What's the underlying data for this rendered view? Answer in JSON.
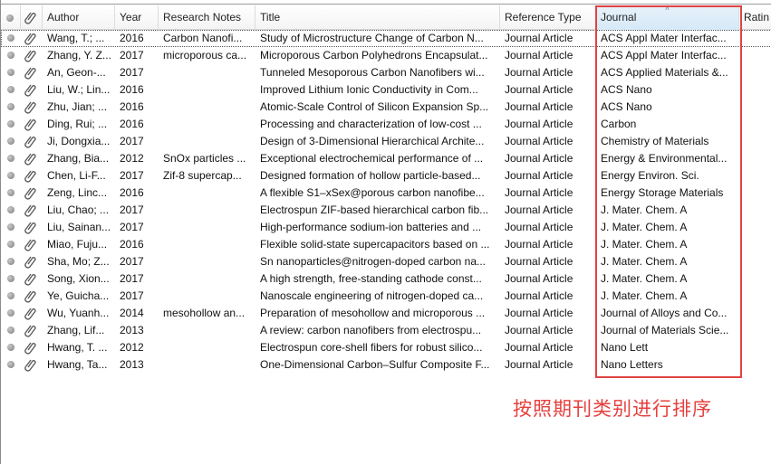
{
  "columns": {
    "author": "Author",
    "year": "Year",
    "notes": "Research Notes",
    "title": "Title",
    "reftype": "Reference Type",
    "journal": "Journal",
    "rating": "Ratin"
  },
  "sort_indicator": "^",
  "rows": [
    {
      "author": "Wang, T.; ...",
      "year": "2016",
      "notes": "Carbon Nanofi...",
      "title": "Study of Microstructure Change of Carbon N...",
      "reftype": "Journal Article",
      "journal": "ACS Appl Mater Interfac..."
    },
    {
      "author": "Zhang, Y. Z...",
      "year": "2017",
      "notes": "microporous ca...",
      "title": "Microporous Carbon Polyhedrons Encapsulat...",
      "reftype": "Journal Article",
      "journal": "ACS Appl Mater Interfac..."
    },
    {
      "author": "An, Geon-...",
      "year": "2017",
      "notes": "",
      "title": "Tunneled Mesoporous Carbon Nanofibers wi...",
      "reftype": "Journal Article",
      "journal": "ACS Applied Materials &..."
    },
    {
      "author": "Liu, W.; Lin...",
      "year": "2016",
      "notes": "",
      "title": "Improved Lithium Ionic Conductivity in Com...",
      "reftype": "Journal Article",
      "journal": "ACS Nano"
    },
    {
      "author": "Zhu, Jian; ...",
      "year": "2016",
      "notes": "",
      "title": "Atomic-Scale Control of Silicon Expansion Sp...",
      "reftype": "Journal Article",
      "journal": "ACS Nano"
    },
    {
      "author": "Ding, Rui; ...",
      "year": "2016",
      "notes": "",
      "title": "Processing and characterization of low-cost ...",
      "reftype": "Journal Article",
      "journal": "Carbon"
    },
    {
      "author": "Ji, Dongxia...",
      "year": "2017",
      "notes": "",
      "title": "Design of 3-Dimensional Hierarchical Archite...",
      "reftype": "Journal Article",
      "journal": "Chemistry of Materials"
    },
    {
      "author": "Zhang, Bia...",
      "year": "2012",
      "notes": "SnOx particles ...",
      "title": "Exceptional electrochemical performance of ...",
      "reftype": "Journal Article",
      "journal": "Energy & Environmental..."
    },
    {
      "author": "Chen, Li-F...",
      "year": "2017",
      "notes": "Zif-8 supercap...",
      "title": "Designed formation of hollow particle-based...",
      "reftype": "Journal Article",
      "journal": "Energy Environ. Sci."
    },
    {
      "author": "Zeng, Linc...",
      "year": "2016",
      "notes": "",
      "title": "A flexible S1–xSex@porous carbon nanofibe...",
      "reftype": "Journal Article",
      "journal": "Energy Storage Materials"
    },
    {
      "author": "Liu, Chao; ...",
      "year": "2017",
      "notes": "",
      "title": "Electrospun ZIF-based hierarchical carbon fib...",
      "reftype": "Journal Article",
      "journal": "J. Mater. Chem. A"
    },
    {
      "author": "Liu, Sainan...",
      "year": "2017",
      "notes": "",
      "title": "High-performance sodium-ion batteries and ...",
      "reftype": "Journal Article",
      "journal": "J. Mater. Chem. A"
    },
    {
      "author": "Miao, Fuju...",
      "year": "2016",
      "notes": "",
      "title": "Flexible solid-state supercapacitors based on ...",
      "reftype": "Journal Article",
      "journal": "J. Mater. Chem. A"
    },
    {
      "author": "Sha, Mo; Z...",
      "year": "2017",
      "notes": "",
      "title": "Sn nanoparticles@nitrogen-doped carbon na...",
      "reftype": "Journal Article",
      "journal": "J. Mater. Chem. A"
    },
    {
      "author": "Song, Xion...",
      "year": "2017",
      "notes": "",
      "title": "A high strength, free-standing cathode const...",
      "reftype": "Journal Article",
      "journal": "J. Mater. Chem. A"
    },
    {
      "author": "Ye, Guicha...",
      "year": "2017",
      "notes": "",
      "title": "Nanoscale engineering of nitrogen-doped ca...",
      "reftype": "Journal Article",
      "journal": "J. Mater. Chem. A"
    },
    {
      "author": "Wu, Yuanh...",
      "year": "2014",
      "notes": "mesohollow an...",
      "title": "Preparation of mesohollow and microporous ...",
      "reftype": "Journal Article",
      "journal": "Journal of Alloys and Co..."
    },
    {
      "author": "Zhang, Lif...",
      "year": "2013",
      "notes": "",
      "title": "A review: carbon nanofibers from electrospu...",
      "reftype": "Journal Article",
      "journal": "Journal of Materials Scie..."
    },
    {
      "author": "Hwang, T. ...",
      "year": "2012",
      "notes": "",
      "title": "Electrospun core-shell fibers for robust silico...",
      "reftype": "Journal Article",
      "journal": "Nano Lett"
    },
    {
      "author": "Hwang, Ta...",
      "year": "2013",
      "notes": "",
      "title": "One-Dimensional Carbon–Sulfur Composite F...",
      "reftype": "Journal Article",
      "journal": "Nano Letters"
    }
  ],
  "annotation": {
    "text": "按照期刊类别进行排序",
    "color": "#e5403e"
  },
  "icons": {
    "read_status": "dot-icon",
    "attachment": "paperclip-icon"
  }
}
